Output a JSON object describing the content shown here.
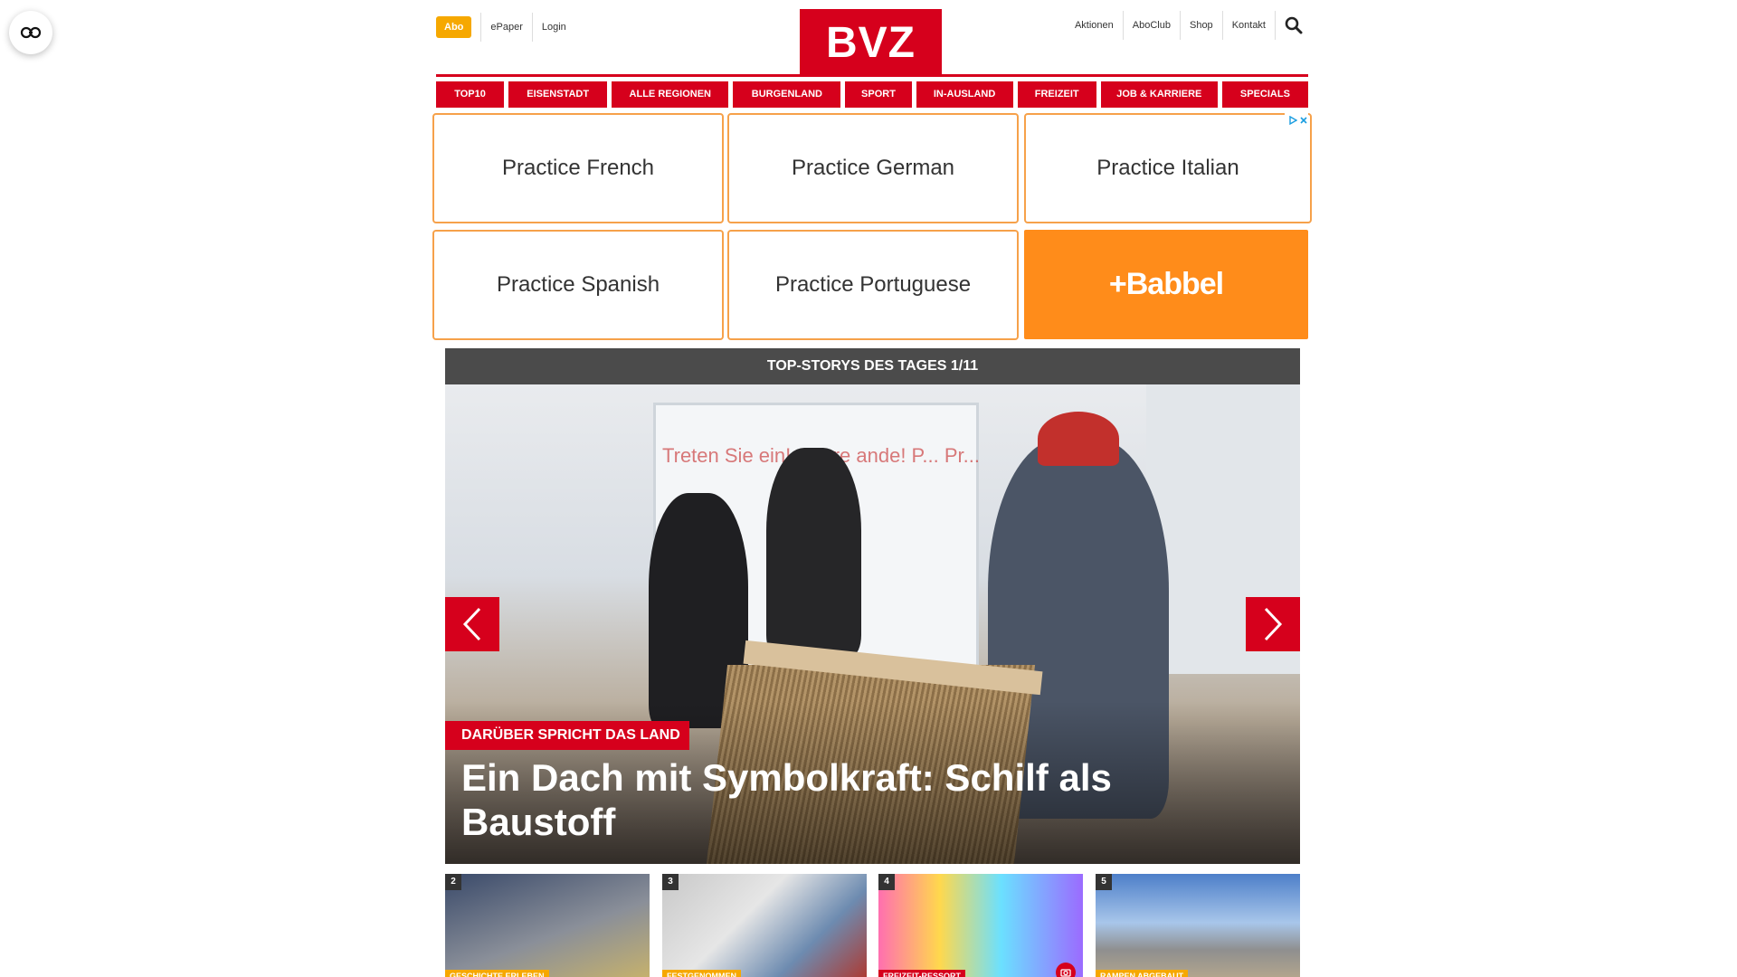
{
  "header": {
    "abo_label": "Abo",
    "epaper_label": "ePaper",
    "login_label": "Login",
    "logo_text": "BVZ",
    "right_links": [
      "Aktionen",
      "AboClub",
      "Shop",
      "Kontakt"
    ]
  },
  "nav": {
    "items": [
      "TOP10",
      "EISENSTADT",
      "ALLE REGIONEN",
      "BURGENLAND",
      "SPORT",
      "IN-AUSLAND",
      "FREIZEIT",
      "JOB & KARRIERE",
      "SPECIALS"
    ]
  },
  "ad": {
    "tiles": [
      "Practice French",
      "Practice German",
      "Practice Italian",
      "Practice Spanish",
      "Practice Portuguese"
    ],
    "brand": "+Babbel"
  },
  "stories": {
    "header": "TOP-STORYS DES TAGES 1/11",
    "hero": {
      "kicker": "DARÜBER SPRICHT DAS LAND",
      "title": "Ein Dach mit Symbolkraft: Schilf als Baustoff",
      "window_text": "Treten Sie ein! Gyere ande! P... Pr..."
    },
    "thumbs": [
      {
        "num": "2",
        "tag": "GESCHICHTE ERLEBEN"
      },
      {
        "num": "3",
        "tag": "FESTGENOMMEN"
      },
      {
        "num": "4",
        "tag": "FREIZEIT-RESSORT"
      },
      {
        "num": "5",
        "tag": "RAMPEN ABGEBAUT"
      }
    ]
  },
  "colors": {
    "brand_red": "#d6001c",
    "abo_orange": "#f6a800",
    "babbel_orange": "#ff8c1a",
    "stories_bar": "#4b4b4b"
  }
}
